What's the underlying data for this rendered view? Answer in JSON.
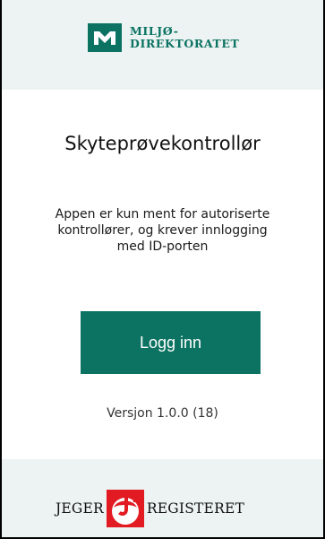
{
  "header": {
    "logo_line1": "MILJØ-",
    "logo_line2": "DIREKTORATET",
    "logo_icon": "miljodirektoratet-logo-icon",
    "brand_color": "#0c7362"
  },
  "main": {
    "title": "Skyteprøvekontrollør",
    "description": "Appen er kun ment for autoriserte kontrollører, og krever innlogging med ID-porten",
    "login_button": "Logg inn",
    "version": "Versjon 1.0.0 (18)"
  },
  "footer": {
    "logo_left": "JEGER",
    "logo_right": "REGISTERET",
    "logo_icon": "jegerregisteret-logo-icon",
    "logo_color": "#e21b23"
  },
  "colors": {
    "panel_background": "#ecf3f2",
    "button_background": "#0c7362",
    "button_text": "#ffffff"
  }
}
